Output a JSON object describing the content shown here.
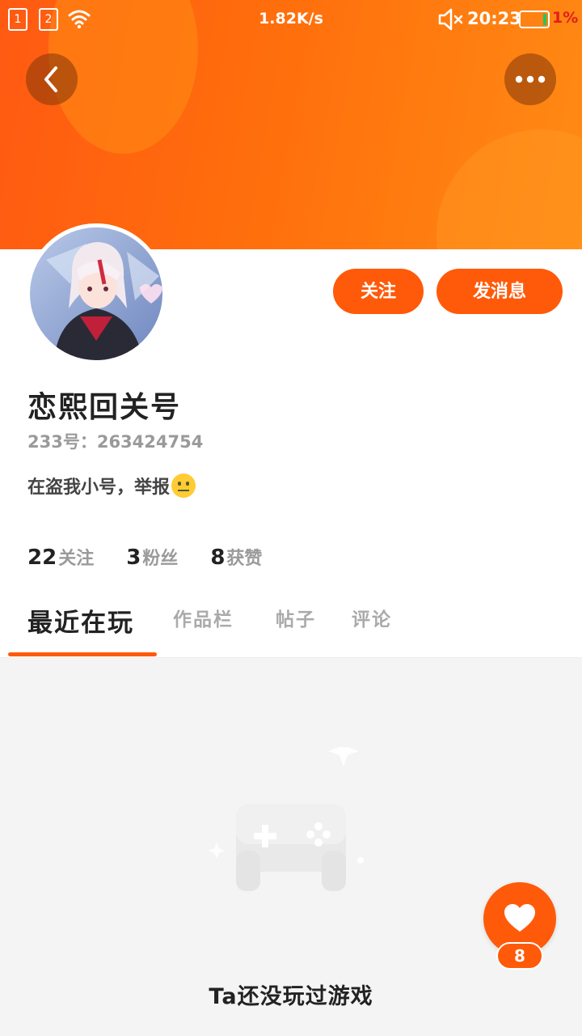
{
  "status_bar": {
    "sim1": "1",
    "sim2": "2",
    "network_speed": "1.82K/s",
    "time": "20:23",
    "battery": "1%"
  },
  "header": {
    "back_icon": "chevron-left-icon",
    "more_icon": "more-horizontal-icon",
    "gradient_start": "#ff5a12",
    "gradient_end": "#ff8a14"
  },
  "profile": {
    "name": "恋熙回关号",
    "id_text": "233号：263424754",
    "bio": "在盗我小号，举报",
    "bio_emoji": "grimacing-face-emoji"
  },
  "actions": {
    "follow_label": "关注",
    "message_label": "发消息"
  },
  "stats": [
    {
      "value": "22",
      "label": "关注"
    },
    {
      "value": "3",
      "label": "粉丝"
    },
    {
      "value": "8",
      "label": "获赞"
    }
  ],
  "tabs": [
    {
      "label": "最近在玩",
      "active": true
    },
    {
      "label": "作品栏",
      "active": false
    },
    {
      "label": "帖子",
      "active": false
    },
    {
      "label": "评论",
      "active": false
    }
  ],
  "empty_state": {
    "icon": "gamepad-icon",
    "message": "Ta还没玩过游戏"
  },
  "like_fab": {
    "icon": "heart-icon",
    "count": "8"
  },
  "accent_color": "#ff5a0a"
}
